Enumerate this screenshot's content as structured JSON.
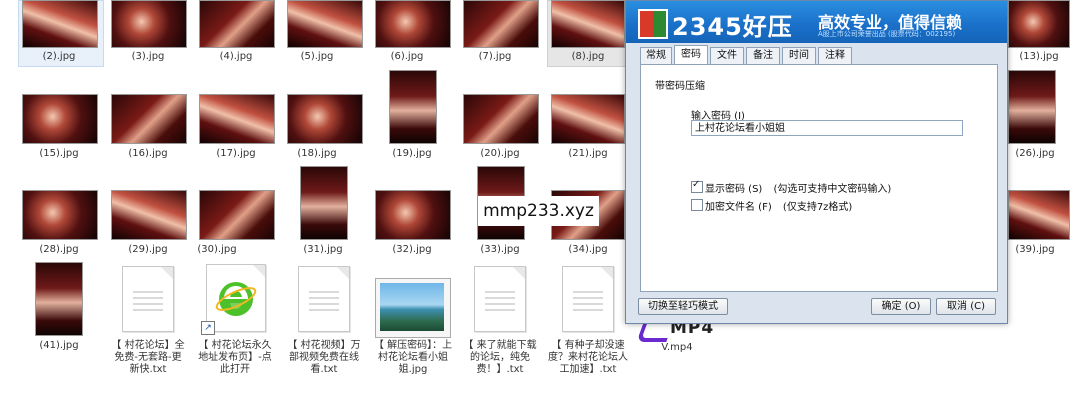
{
  "files_row1": [
    {
      "name": "(2).jpg"
    },
    {
      "name": "(3).jpg"
    },
    {
      "name": "(4).jpg"
    },
    {
      "name": "(5).jpg"
    },
    {
      "name": "(6).jpg"
    },
    {
      "name": "(7).jpg"
    },
    {
      "name": "(8).jpg"
    },
    {
      "name": "(13).jpg"
    }
  ],
  "files_row2": [
    {
      "name": "(15).jpg"
    },
    {
      "name": "(16).jpg"
    },
    {
      "name": "(17).jpg"
    },
    {
      "name": "(18).jpg"
    },
    {
      "name": "(19).jpg"
    },
    {
      "name": "(20).jpg"
    },
    {
      "name": "(21).jpg"
    },
    {
      "name": "(26).jpg"
    }
  ],
  "files_row3": [
    {
      "name": "(28).jpg"
    },
    {
      "name": "(29).jpg"
    },
    {
      "name": "(30).jpg"
    },
    {
      "name": "(31).jpg"
    },
    {
      "name": "(32).jpg"
    },
    {
      "name": "(33).jpg"
    },
    {
      "name": "(34).jpg"
    },
    {
      "name": "(39).jpg"
    }
  ],
  "files_row4": [
    {
      "name": "(41).jpg"
    },
    {
      "name": "【 村花论坛】全免费-无套路-更新快.txt"
    },
    {
      "name": "【 村花论坛永久地址发布页】-点此打开"
    },
    {
      "name": "【 村花视频】万部视频免费在线看.txt"
    },
    {
      "name": "【 解压密码】：上村花论坛看小姐姐.jpg"
    },
    {
      "name": "【 来了就能下载的论坛，纯免费！】.txt"
    },
    {
      "name": "【 有种子却没速度？来村花论坛人工加速】.txt"
    },
    {
      "name": "V.mp4"
    }
  ],
  "dialog": {
    "brand": "2345好压",
    "slogan": "高效专业，值得信赖",
    "subline": "A股上市公司荣誉出品 (股票代码：002195)",
    "tabs": [
      "常规",
      "密码",
      "文件",
      "备注",
      "时间",
      "注释"
    ],
    "active_tab": "密码",
    "group_title": "带密码压缩",
    "password_label": "输入密码 (I)",
    "password_value": "上村花论坛看小姐姐",
    "show_password_label": "显示密码 (S)",
    "show_password_hint": "(勾选可支持中文密码输入)",
    "show_password_checked": true,
    "encrypt_names_label": "加密文件名 (F)",
    "encrypt_names_hint": "(仅支持7z格式)",
    "encrypt_names_checked": false,
    "switch_mode_button": "切换至轻巧模式",
    "ok_button": "确定 (O)",
    "cancel_button": "取消 (C)",
    "colors": {
      "banner": "#1a6fc8",
      "panel": "#dbe4ee"
    }
  },
  "watermark": "mmp233.xyz",
  "mp4_badge": "MP4"
}
